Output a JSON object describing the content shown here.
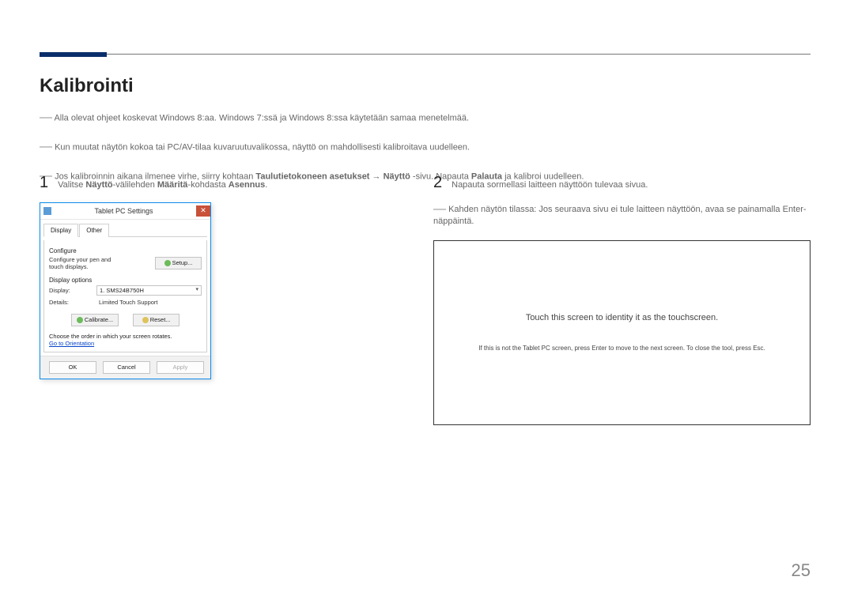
{
  "header": {
    "title": "Kalibrointi"
  },
  "intro": {
    "line1_pre": "Alla olevat ohjeet koskevat Windows 8:aa. Windows 7:ssä ja Windows 8:ssa käytetään samaa menetelmää.",
    "line2_pre": "Kun muutat näytön kokoa tai PC/AV-tilaa kuvaruutuvalikossa, näyttö on mahdollisesti kalibroitava uudelleen.",
    "line3_pre": "Jos kalibroinnin aikana ilmenee virhe, siirry kohtaan ",
    "line3_bold1": "Taulutietokoneen asetukset",
    "line3_arrow": " → ",
    "line3_bold2": "Näyttö",
    "line3_mid": "-sivu. Napauta ",
    "line3_bold3": "Palauta",
    "line3_end": " ja kalibroi uudelleen."
  },
  "left": {
    "step_num": "1",
    "step_pre": "Valitse ",
    "b1": "Näyttö",
    "t1": "-välilehden ",
    "b2": "Määritä",
    "t2": "-kohdasta ",
    "b3": "Asennus",
    "t3": "."
  },
  "right": {
    "step_num": "2",
    "step_text": "Napauta sormellasi laitteen näyttöön tulevaa sivua.",
    "note_dash": "―",
    "note_text": "Kahden näytön tilassa: Jos seuraava sivu ei tule laitteen näyttöön, avaa se painamalla Enter-näppäintä."
  },
  "dialog": {
    "title": "Tablet PC Settings",
    "close": "✕",
    "tabs": {
      "display": "Display",
      "other": "Other"
    },
    "configure_label": "Configure",
    "configure_text": "Configure your pen and touch displays.",
    "setup_btn": "Setup...",
    "display_options_label": "Display options",
    "display_label": "Display:",
    "display_value": "1. SMS24B750H",
    "details_label": "Details:",
    "details_value": "Limited Touch Support",
    "calibrate_btn": "Calibrate...",
    "reset_btn": "Reset...",
    "rotate_text": "Choose the order in which your screen rotates.",
    "orientation_link": "Go to Orientation",
    "ok": "OK",
    "cancel": "Cancel",
    "apply": "Apply"
  },
  "touch": {
    "main": "Touch this screen to identity it as the touchscreen.",
    "sub": "If this is not the Tablet PC screen, press Enter to move to the next screen. To close the tool, press Esc."
  },
  "page_number": "25",
  "chart_data": null
}
